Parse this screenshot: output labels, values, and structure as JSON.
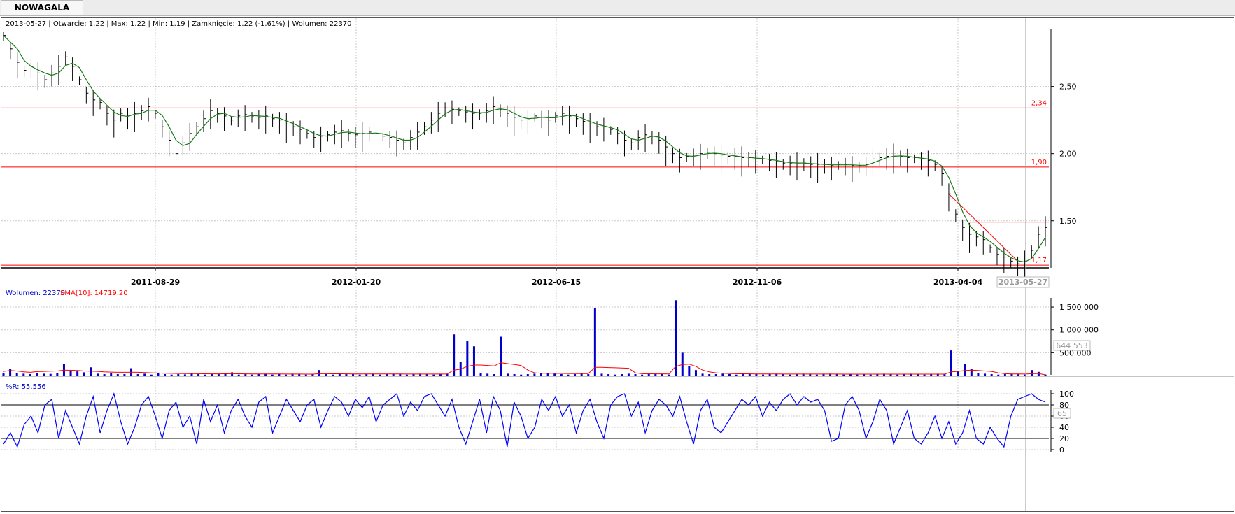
{
  "tab": {
    "label": "NOWAGALA"
  },
  "info_line": "2013-05-27 | Otwarcie: 1.22 | Max: 1.22 | Min: 1.19 | Zamknięcie: 1.22 (-1.61%)  | Wolumen: 22370",
  "colors": {
    "price": "#000000",
    "sma": "#1a7a1a",
    "hline": "#ff0000",
    "volume": "#0000cc",
    "vol_sma": "#ff0000",
    "wr": "#0000ff",
    "grid": "#c8c8c8"
  },
  "chart_data": [
    {
      "type": "line",
      "title": "",
      "xlabel": "",
      "ylabel": "",
      "x_ticks": [
        "2011-08-29",
        "2012-01-20",
        "2012-06-15",
        "2012-11-06",
        "2013-04-04"
      ],
      "x_current": "2013-05-27",
      "y_ticks": [
        "2,50",
        "2,00",
        "1,50"
      ],
      "ylim": [
        1.15,
        2.93
      ],
      "grid": true,
      "series": [
        {
          "values": [
            2.88,
            2.78,
            2.68,
            2.62,
            2.65,
            2.6,
            2.55,
            2.6,
            2.65,
            2.72,
            2.65,
            2.55,
            2.45,
            2.4,
            2.38,
            2.3,
            2.25,
            2.3,
            2.28,
            2.3,
            2.32,
            2.35,
            2.3,
            2.2,
            2.1,
            2.0,
            2.08,
            2.15,
            2.2,
            2.26,
            2.32,
            2.3,
            2.28,
            2.25,
            2.28,
            2.29,
            2.28,
            2.27,
            2.28,
            2.26,
            2.25,
            2.22,
            2.2,
            2.18,
            2.15,
            2.12,
            2.13,
            2.14,
            2.16,
            2.17,
            2.15,
            2.14,
            2.15,
            2.16,
            2.15,
            2.13,
            2.12,
            2.1,
            2.08,
            2.12,
            2.16,
            2.2,
            2.25,
            2.3,
            2.34,
            2.33,
            2.32,
            2.31,
            2.3,
            2.3,
            2.32,
            2.35,
            2.33,
            2.3,
            2.27,
            2.25,
            2.26,
            2.28,
            2.27,
            2.25,
            2.28,
            2.3,
            2.28,
            2.26,
            2.24,
            2.22,
            2.2,
            2.2,
            2.18,
            2.15,
            2.1,
            2.08,
            2.12,
            2.14,
            2.13,
            2.1,
            2.05,
            2.0,
            1.97,
            1.98,
            1.99,
            2.0,
            2.01,
            2.0,
            1.99,
            1.98,
            1.98,
            1.97,
            1.97,
            1.96,
            1.96,
            1.95,
            1.94,
            1.93,
            1.93,
            1.93,
            1.93,
            1.92,
            1.92,
            1.92,
            1.91,
            1.92,
            1.92,
            1.91,
            1.91,
            1.92,
            1.96,
            1.97,
            1.98,
            1.99,
            1.98,
            1.97,
            1.97,
            1.96,
            1.95,
            1.92,
            1.85,
            1.7,
            1.55,
            1.45,
            1.4,
            1.38,
            1.36,
            1.3,
            1.25,
            1.23,
            1.2,
            1.18,
            1.2,
            1.28,
            1.4,
            1.45
          ]
        }
      ],
      "annotations": [
        "2,34",
        "1,90",
        "1,17"
      ]
    },
    {
      "type": "bar",
      "title": "",
      "legend": [
        "Wolumen: 22370",
        "SMA[10]: 14719.20"
      ],
      "y_ticks": [
        "1 500 000",
        "1 000 000",
        "500 000"
      ],
      "ylim": [
        0,
        1700000
      ],
      "grid": true,
      "marker_value": "644 553",
      "series": [
        {
          "name": "Wolumen",
          "values": [
            60000,
            150000,
            50000,
            40000,
            30000,
            50000,
            40000,
            35000,
            60000,
            260000,
            120000,
            90000,
            70000,
            180000,
            40000,
            30000,
            60000,
            30000,
            30000,
            160000,
            30000,
            40000,
            20000,
            50000,
            30000,
            20000,
            30000,
            25000,
            40000,
            30000,
            20000,
            30000,
            30000,
            40000,
            70000,
            20000,
            30000,
            20000,
            30000,
            40000,
            20000,
            30000,
            20000,
            40000,
            30000,
            20000,
            30000,
            120000,
            30000,
            20000,
            40000,
            30000,
            30000,
            20000,
            30000,
            40000,
            20000,
            30000,
            40000,
            30000,
            20000,
            30000,
            40000,
            30000,
            20000,
            30000,
            40000,
            900000,
            300000,
            750000,
            640000,
            50000,
            40000,
            30000,
            850000,
            40000,
            30000,
            20000,
            30000,
            40000,
            50000,
            60000,
            40000,
            30000,
            20000,
            30000,
            40000,
            30000,
            1480000,
            40000,
            30000,
            20000,
            30000,
            40000,
            30000,
            20000,
            30000,
            40000,
            30000,
            20000,
            1650000,
            500000,
            200000,
            120000,
            40000,
            30000,
            30000,
            40000,
            30000,
            20000,
            30000,
            40000,
            30000,
            20000,
            30000,
            40000,
            30000,
            20000,
            30000,
            40000,
            30000,
            20000,
            30000,
            40000,
            30000,
            20000,
            30000,
            20000,
            30000,
            20000,
            30000,
            40000,
            30000,
            20000,
            30000,
            40000,
            30000,
            20000,
            30000,
            40000,
            30000,
            550000,
            100000,
            250000,
            150000,
            60000,
            40000,
            30000,
            20000,
            30000,
            40000,
            30000,
            20000,
            120000,
            80000,
            22370
          ]
        },
        {
          "name": "SMA[10]",
          "values": [
            90000,
            110000,
            100000,
            80000,
            70000,
            85000,
            90000,
            95000,
            100000,
            120000,
            115000,
            110000,
            100000,
            95000,
            90000,
            80000,
            75000,
            70000,
            70000,
            72000,
            70000,
            65000,
            60000,
            55000,
            50000,
            48000,
            45000,
            43000,
            42000,
            40000,
            38000,
            36000,
            36000,
            38000,
            40000,
            38000,
            36000,
            34000,
            34000,
            35000,
            34000,
            33000,
            32000,
            32000,
            32000,
            31000,
            31000,
            40000,
            40000,
            39000,
            38000,
            36000,
            35000,
            34000,
            34000,
            34000,
            33000,
            33000,
            33000,
            33000,
            32000,
            32000,
            32000,
            32000,
            32000,
            32000,
            33000,
            120000,
            140000,
            200000,
            230000,
            230000,
            220000,
            210000,
            280000,
            260000,
            240000,
            220000,
            120000,
            60000,
            50000,
            50000,
            48000,
            46000,
            44000,
            43000,
            42000,
            41000,
            180000,
            180000,
            175000,
            170000,
            165000,
            160000,
            60000,
            40000,
            38000,
            37000,
            36000,
            35000,
            200000,
            240000,
            250000,
            200000,
            120000,
            80000,
            60000,
            50000,
            45000,
            40000,
            38000,
            36000,
            35000,
            34000,
            33000,
            33000,
            32000,
            32000,
            32000,
            32000,
            32000,
            32000,
            32000,
            32000,
            32000,
            31000,
            31000,
            31000,
            31000,
            31000,
            31000,
            31000,
            31000,
            31000,
            31000,
            31000,
            31000,
            31000,
            31000,
            31000,
            31000,
            80000,
            90000,
            110000,
            120000,
            110000,
            100000,
            90000,
            60000,
            40000,
            35000,
            33000,
            32000,
            40000,
            45000,
            14719.2
          ]
        }
      ]
    },
    {
      "type": "line",
      "title": "",
      "legend": [
        "%R: 55.556"
      ],
      "y_ticks": [
        "100",
        "80",
        "60",
        "40",
        "20",
        "0"
      ],
      "ylim": [
        0,
        100
      ],
      "hlines": [
        80,
        20
      ],
      "marker_value": "65",
      "series": [
        {
          "name": "%R",
          "values": [
            10,
            30,
            5,
            45,
            60,
            30,
            80,
            90,
            20,
            70,
            40,
            10,
            60,
            95,
            30,
            70,
            100,
            50,
            10,
            40,
            80,
            95,
            60,
            20,
            70,
            85,
            40,
            60,
            10,
            90,
            50,
            80,
            30,
            70,
            90,
            60,
            40,
            85,
            95,
            30,
            60,
            90,
            70,
            50,
            80,
            90,
            40,
            70,
            95,
            85,
            60,
            90,
            75,
            95,
            50,
            80,
            90,
            100,
            60,
            85,
            70,
            95,
            100,
            80,
            60,
            90,
            40,
            10,
            50,
            90,
            30,
            95,
            70,
            5,
            85,
            60,
            20,
            40,
            90,
            70,
            95,
            60,
            80,
            30,
            70,
            90,
            50,
            20,
            80,
            95,
            100,
            60,
            85,
            30,
            70,
            90,
            80,
            60,
            95,
            50,
            10,
            70,
            90,
            40,
            30,
            50,
            70,
            90,
            80,
            95,
            60,
            85,
            70,
            90,
            100,
            80,
            95,
            85,
            90,
            70,
            15,
            20,
            80,
            95,
            70,
            20,
            50,
            90,
            70,
            10,
            40,
            70,
            20,
            10,
            30,
            60,
            20,
            50,
            10,
            30,
            70,
            20,
            10,
            40,
            20,
            5,
            60,
            90,
            95,
            100,
            90,
            85
          ]
        }
      ]
    }
  ]
}
